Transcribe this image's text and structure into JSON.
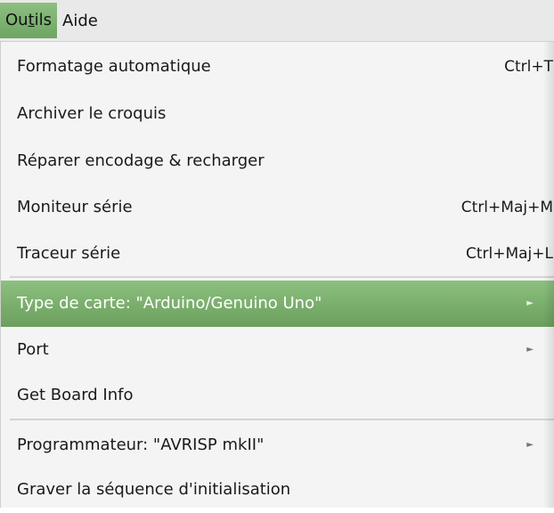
{
  "menubar": {
    "tools_prefix": "Ou",
    "tools_mnemonic": "t",
    "tools_suffix": "ils",
    "help": "Aide"
  },
  "menu": {
    "items": [
      {
        "label": "Formatage automatique",
        "shortcut": "Ctrl+T"
      },
      {
        "label": "Archiver le croquis",
        "shortcut": ""
      },
      {
        "label": "Réparer encodage & recharger",
        "shortcut": ""
      },
      {
        "label": "Moniteur série",
        "shortcut": "Ctrl+Maj+M"
      },
      {
        "label": "Traceur série",
        "shortcut": "Ctrl+Maj+L"
      },
      {
        "label": "Type de carte: \"Arduino/Genuino Uno\"",
        "submenu": true
      },
      {
        "label": "Port",
        "submenu": true
      },
      {
        "label": "Get Board Info"
      },
      {
        "label": "Programmateur: \"AVRISP mkII\"",
        "submenu": true
      },
      {
        "label": "Graver la séquence d'initialisation"
      }
    ],
    "submenu_arrow": "►"
  },
  "colors": {
    "highlight": "#7ab06e",
    "menu_bg": "#f4f4f4",
    "menubar_bg": "#e9e9e9"
  }
}
